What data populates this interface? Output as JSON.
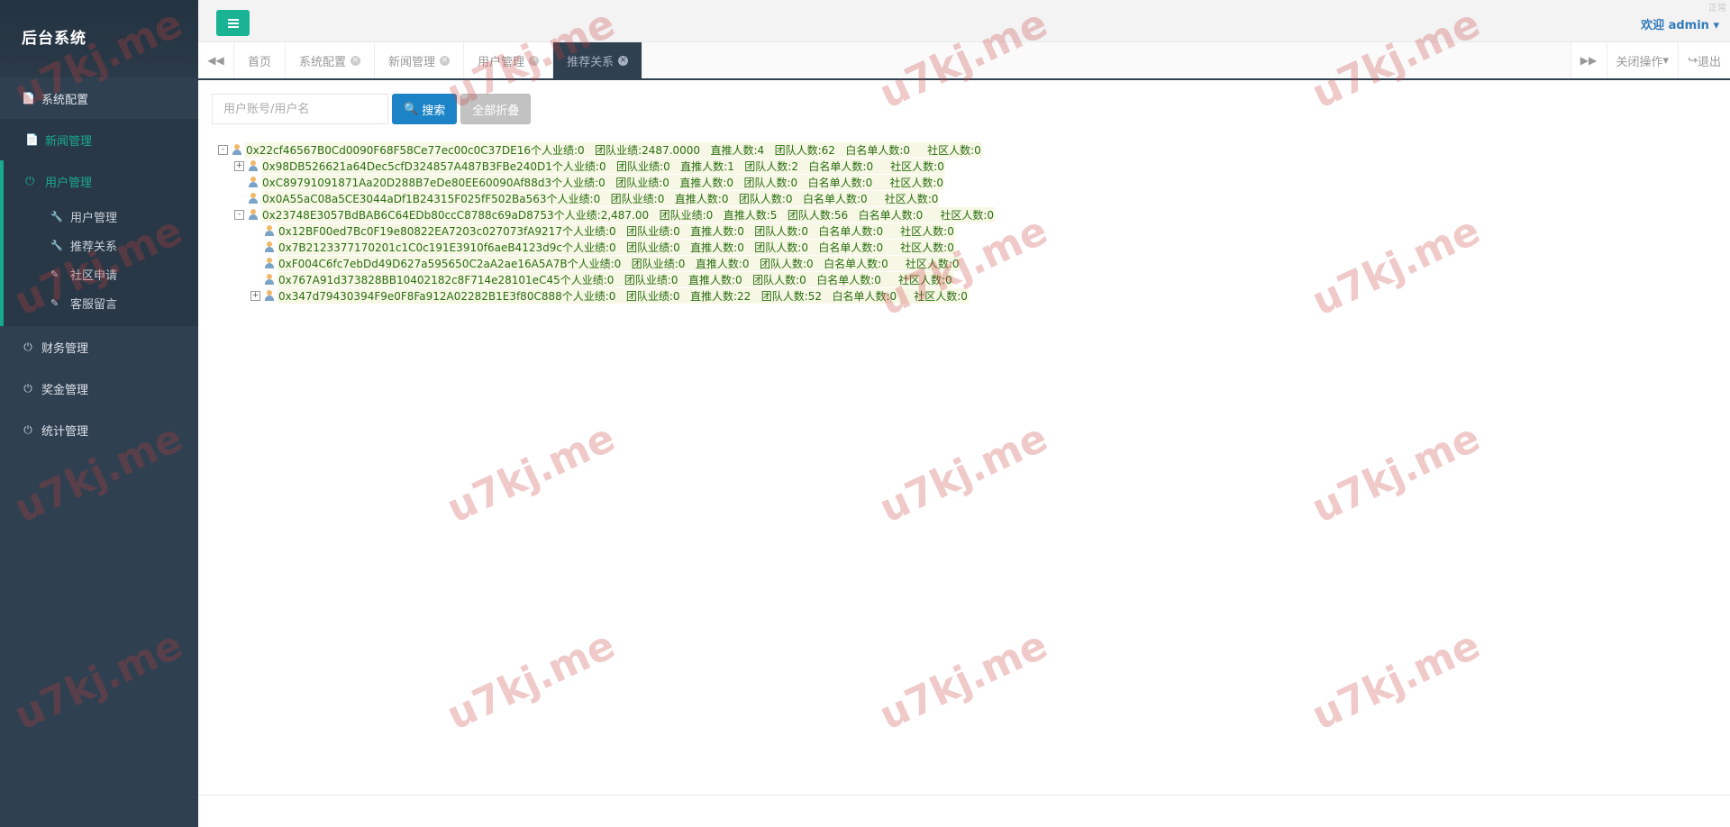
{
  "sidebar": {
    "brand": "后台系统",
    "items": [
      {
        "label": "系统配置",
        "icon": "document-icon"
      },
      {
        "label": "新闻管理",
        "icon": "document-icon"
      }
    ],
    "group": {
      "label": "用户管理",
      "icon": "power-icon",
      "children": [
        {
          "label": "用户管理",
          "icon": "wrench-icon"
        },
        {
          "label": "推荐关系",
          "icon": "wrench-icon"
        },
        {
          "label": "社区申请",
          "icon": "edit-icon"
        },
        {
          "label": "客服留言",
          "icon": "edit-icon"
        }
      ]
    },
    "items_after": [
      {
        "label": "财务管理",
        "icon": "power-icon"
      },
      {
        "label": "奖金管理",
        "icon": "power-icon"
      },
      {
        "label": "统计管理",
        "icon": "power-icon"
      }
    ]
  },
  "header": {
    "welcome": "欢迎 admin",
    "corner": "正常"
  },
  "tabs": {
    "items": [
      "首页",
      "系统配置",
      "新闻管理",
      "用户管理",
      "推荐关系"
    ],
    "active_index": 4,
    "close_ops": "关闭操作",
    "logout": "退出"
  },
  "search": {
    "placeholder": "用户账号/用户名",
    "search_label": "搜索",
    "collapse_label": "全部折叠"
  },
  "tree": [
    {
      "depth": 0,
      "toggle": "-",
      "text": "0x22cf46567B0Cd0090F68F58Ce77ec00c0C37DE16个人业绩:0   团队业绩:2487.0000   直推人数:4   团队人数:62   白名单人数:0     社区人数:0"
    },
    {
      "depth": 1,
      "toggle": "+",
      "text": "0x98DB526621a64Dec5cfD324857A487B3FBe240D1个人业绩:0   团队业绩:0   直推人数:1   团队人数:2   白名单人数:0     社区人数:0"
    },
    {
      "depth": 1,
      "toggle": "",
      "text": "0xC89791091871Aa20D288B7eDe80EE60090Af88d3个人业绩:0   团队业绩:0   直推人数:0   团队人数:0   白名单人数:0     社区人数:0"
    },
    {
      "depth": 1,
      "toggle": "",
      "text": "0x0A55aC08a5CE3044aDf1B24315F025fF502Ba563个人业绩:0   团队业绩:0   直推人数:0   团队人数:0   白名单人数:0     社区人数:0"
    },
    {
      "depth": 1,
      "toggle": "-",
      "text": "0x23748E3057BdBAB6C64EDb80ccC8788c69aD8753个人业绩:2,487.00   团队业绩:0   直推人数:5   团队人数:56   白名单人数:0     社区人数:0"
    },
    {
      "depth": 2,
      "toggle": "",
      "text": "0x12BF00ed7Bc0F19e80822EA7203c027073fA9217个人业绩:0   团队业绩:0   直推人数:0   团队人数:0   白名单人数:0     社区人数:0"
    },
    {
      "depth": 2,
      "toggle": "",
      "text": "0x7B2123377170201c1C0c191E3910f6aeB4123d9c个人业绩:0   团队业绩:0   直推人数:0   团队人数:0   白名单人数:0     社区人数:0"
    },
    {
      "depth": 2,
      "toggle": "",
      "text": "0xF004C6fc7ebDd49D627a595650C2aA2ae16A5A7B个人业绩:0   团队业绩:0   直推人数:0   团队人数:0   白名单人数:0     社区人数:0"
    },
    {
      "depth": 2,
      "toggle": "",
      "text": "0x767A91d373828BB10402182c8F714e28101eC45个人业绩:0   团队业绩:0   直推人数:0   团队人数:0   白名单人数:0     社区人数:0"
    },
    {
      "depth": 2,
      "toggle": "+",
      "text": "0x347d79430394F9e0F8Fa912A02282B1E3f80C888个人业绩:0   团队业绩:0   直推人数:22   团队人数:52   白名单人数:0     社区人数:0"
    }
  ],
  "watermark": "u7kj.me",
  "colors": {
    "sidebar_bg": "#2f4050",
    "accent": "#1ab394",
    "active_green": "#19aa8d",
    "primary_blue": "#1c84c6",
    "tree_text": "#2a6e10"
  }
}
